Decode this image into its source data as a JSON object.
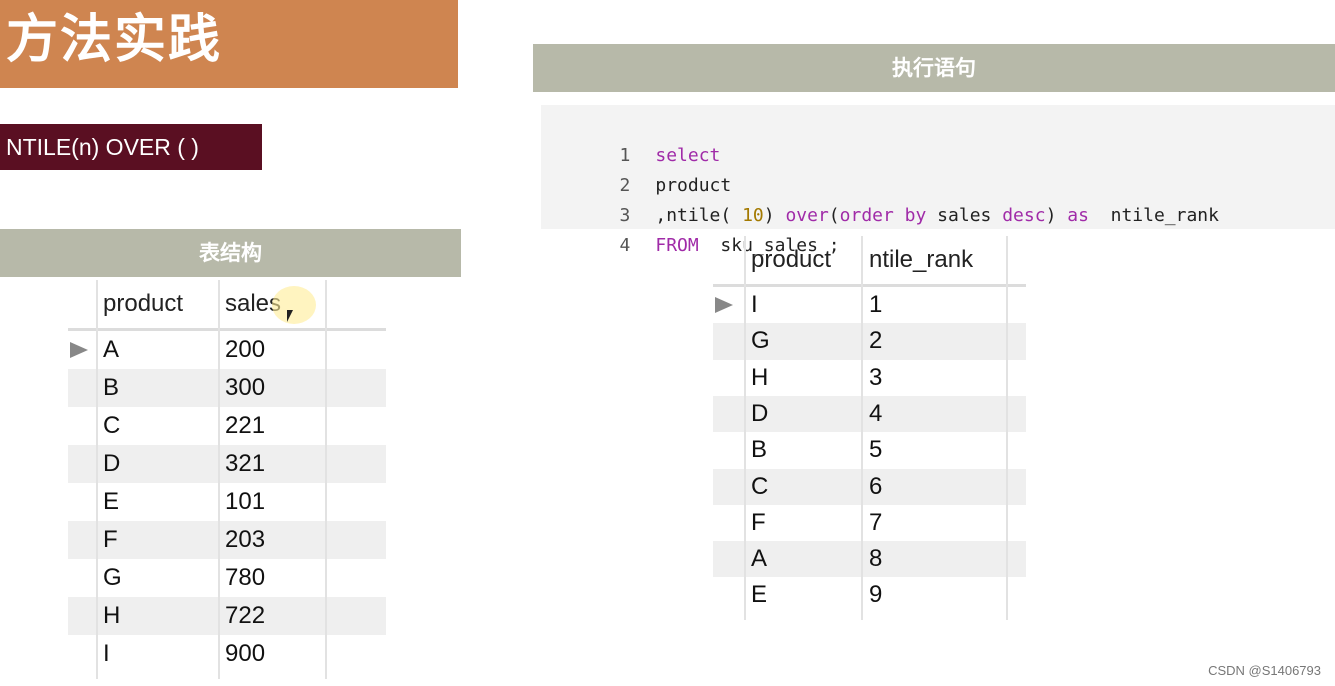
{
  "title": "方法实践",
  "function_label": "NTILE(n) OVER ( )",
  "left_section": {
    "heading": "表结构",
    "columns": [
      "product",
      "sales"
    ],
    "rows": [
      [
        "A",
        "200"
      ],
      [
        "B",
        "300"
      ],
      [
        "C",
        "221"
      ],
      [
        "D",
        "321"
      ],
      [
        "E",
        "101"
      ],
      [
        "F",
        "203"
      ],
      [
        "G",
        "780"
      ],
      [
        "H",
        "722"
      ],
      [
        "I",
        "900"
      ]
    ]
  },
  "right_section": {
    "heading": "执行语句",
    "code": {
      "line_numbers": [
        "1",
        "2",
        "3",
        "4"
      ],
      "line1": {
        "kw": "select"
      },
      "line2": {
        "text": "product"
      },
      "line3": {
        "a": ",ntile( ",
        "num": "10",
        "b": ") ",
        "over": "over",
        "c": "(",
        "order_by": "order by",
        "d": " sales ",
        "desc": "desc",
        "e": ") ",
        "as": "as",
        "f": "  ntile_rank"
      },
      "line4": {
        "kw": "FROM",
        "text": "  sku_sales ;"
      }
    },
    "result": {
      "columns": [
        "product",
        "ntile_rank"
      ],
      "rows": [
        [
          "I",
          "1"
        ],
        [
          "G",
          "2"
        ],
        [
          "H",
          "3"
        ],
        [
          "D",
          "4"
        ],
        [
          "B",
          "5"
        ],
        [
          "C",
          "6"
        ],
        [
          "F",
          "7"
        ],
        [
          "A",
          "8"
        ],
        [
          "E",
          "9"
        ]
      ]
    }
  },
  "watermark": "CSDN @S1406793",
  "colors": {
    "title_banner": "#cf8550",
    "function_box": "#5a0f22",
    "section_bar": "#b7b9a9",
    "keyword": "#a02ba8",
    "number": "#a37900"
  }
}
